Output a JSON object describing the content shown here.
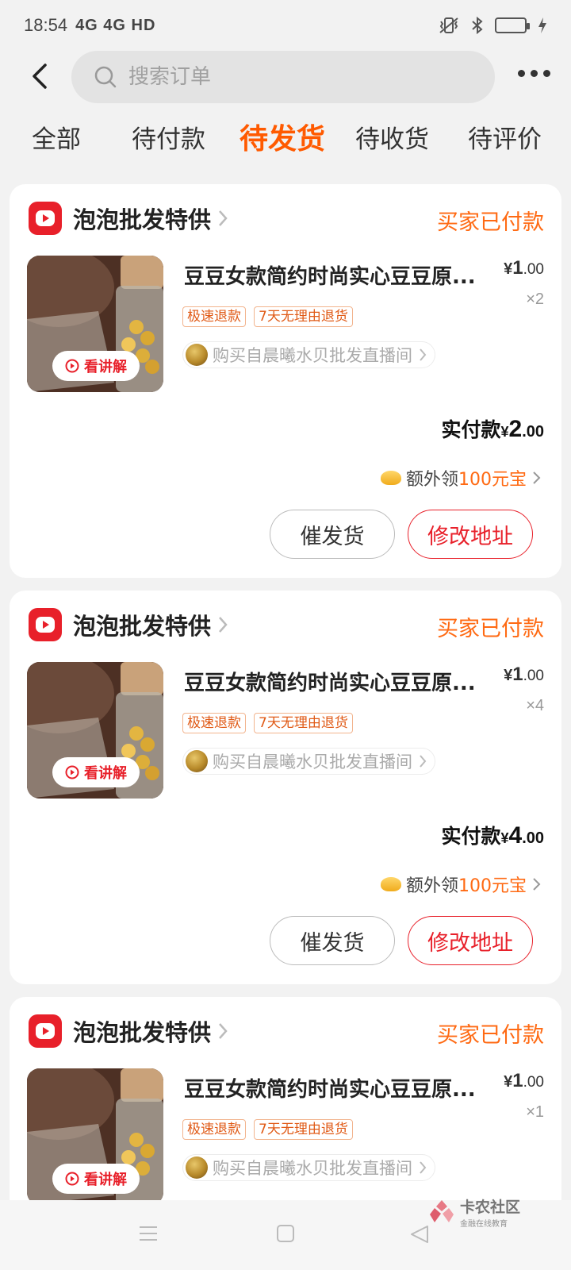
{
  "status_bar": {
    "time": "18:54",
    "network": "4G 4G HD"
  },
  "search": {
    "placeholder": "搜索订单"
  },
  "tabs": [
    {
      "label": "全部"
    },
    {
      "label": "待付款"
    },
    {
      "label": "待发货"
    },
    {
      "label": "待收货"
    },
    {
      "label": "待评价"
    }
  ],
  "active_tab": "待发货",
  "orders": [
    {
      "shop_name": "泡泡批发特供",
      "status": "买家已付款",
      "explain_label": "看讲解",
      "title": "豆豆女款简约时尚实心豆豆原...",
      "price_currency": "¥",
      "price_int": "1",
      "price_dec": ".00",
      "quantity": "×2",
      "tags": [
        "极速退款",
        "7天无理由退货"
      ],
      "live_text": "购买自晨曦水贝批发直播间",
      "paid_label": "实付款",
      "paid_currency": "¥",
      "paid_int": "2",
      "paid_dec": ".00",
      "bonus_prefix": "额外领",
      "bonus_amount": "100元宝",
      "urge_label": "催发货",
      "address_label": "修改地址"
    },
    {
      "shop_name": "泡泡批发特供",
      "status": "买家已付款",
      "explain_label": "看讲解",
      "title": "豆豆女款简约时尚实心豆豆原...",
      "price_currency": "¥",
      "price_int": "1",
      "price_dec": ".00",
      "quantity": "×4",
      "tags": [
        "极速退款",
        "7天无理由退货"
      ],
      "live_text": "购买自晨曦水贝批发直播间",
      "paid_label": "实付款",
      "paid_currency": "¥",
      "paid_int": "4",
      "paid_dec": ".00",
      "bonus_prefix": "额外领",
      "bonus_amount": "100元宝",
      "urge_label": "催发货",
      "address_label": "修改地址"
    },
    {
      "shop_name": "泡泡批发特供",
      "status": "买家已付款",
      "explain_label": "看讲解",
      "title": "豆豆女款简约时尚实心豆豆原...",
      "price_currency": "¥",
      "price_int": "1",
      "price_dec": ".00",
      "quantity": "×1",
      "tags": [
        "极速退款",
        "7天无理由退货"
      ],
      "live_text": "购买自晨曦水贝批发直播间"
    }
  ],
  "watermark": {
    "title": "卡农社区",
    "subtitle": "金融在线教育"
  },
  "colors": {
    "accent": "#ff5a00",
    "brand_red": "#e8202a",
    "status_orange": "#ff6a13"
  },
  "icons": [
    "back-arrow-icon",
    "search-icon",
    "more-icon",
    "chevron-right-icon",
    "shop-play-icon",
    "play-circle-icon",
    "gold-ingot-icon",
    "nav-menu-icon",
    "nav-home-icon",
    "nav-back-icon"
  ]
}
